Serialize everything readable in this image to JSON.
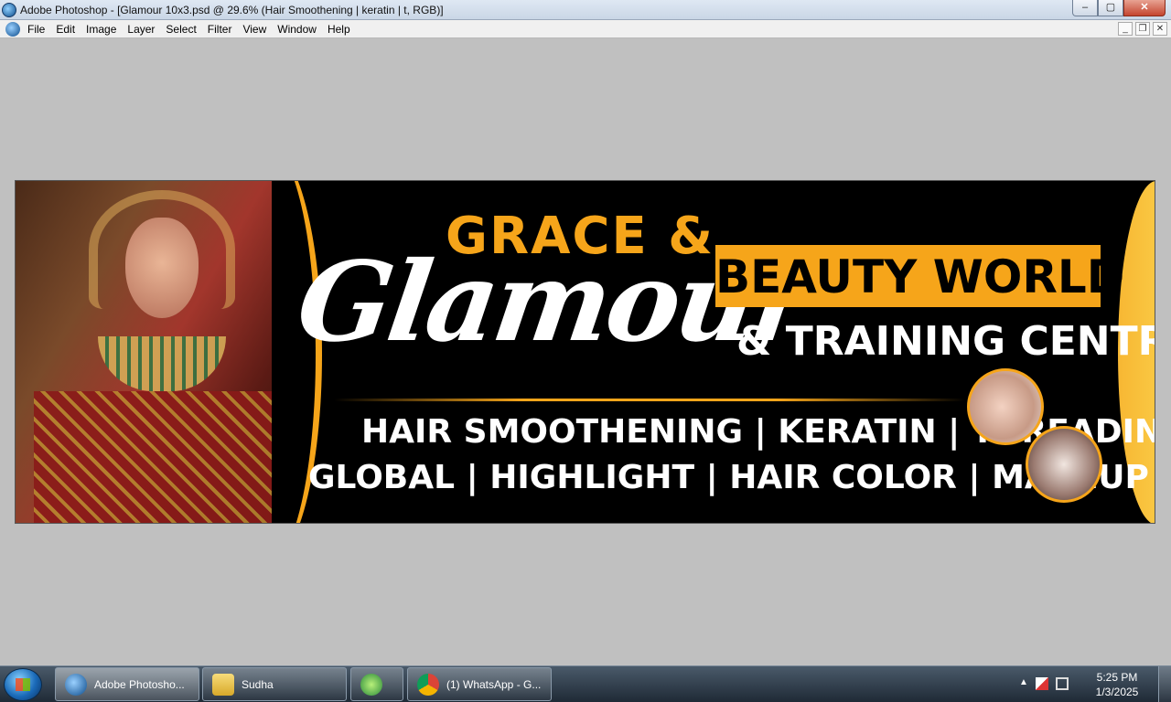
{
  "window": {
    "title": "Adobe Photoshop - [Glamour 10x3.psd @ 29.6% (Hair Smoothening | keratin | t, RGB)]",
    "minimize": "–",
    "maximize": "▢",
    "close": "✕"
  },
  "menu": {
    "items": [
      "File",
      "Edit",
      "Image",
      "Layer",
      "Select",
      "Filter",
      "View",
      "Window",
      "Help"
    ],
    "doc_minimize": "_",
    "doc_restore": "❐",
    "doc_close": "✕"
  },
  "banner": {
    "line_grace": "GRACE &",
    "line_glamour": "Glamour",
    "line_beauty": "BEAUTY WORLD",
    "line_training": "& TRAINING CENTRE",
    "services_1": "HAIR SMOOTHENING | KERATIN | THREADING",
    "services_2": "GLOBAL | HIGHLIGHT | HAIR COLOR | MAKEUP ARTIST",
    "accent_color": "#f6a51a"
  },
  "taskbar": {
    "tasks": [
      {
        "label": "Adobe Photosho...",
        "icon": "photoshop-icon"
      },
      {
        "label": "Sudha",
        "icon": "folder-icon"
      },
      {
        "label": "",
        "icon": "green-app-icon"
      },
      {
        "label": "(1) WhatsApp - G...",
        "icon": "chrome-icon"
      }
    ],
    "clock_time": "5:25 PM",
    "clock_date": "1/3/2025"
  }
}
